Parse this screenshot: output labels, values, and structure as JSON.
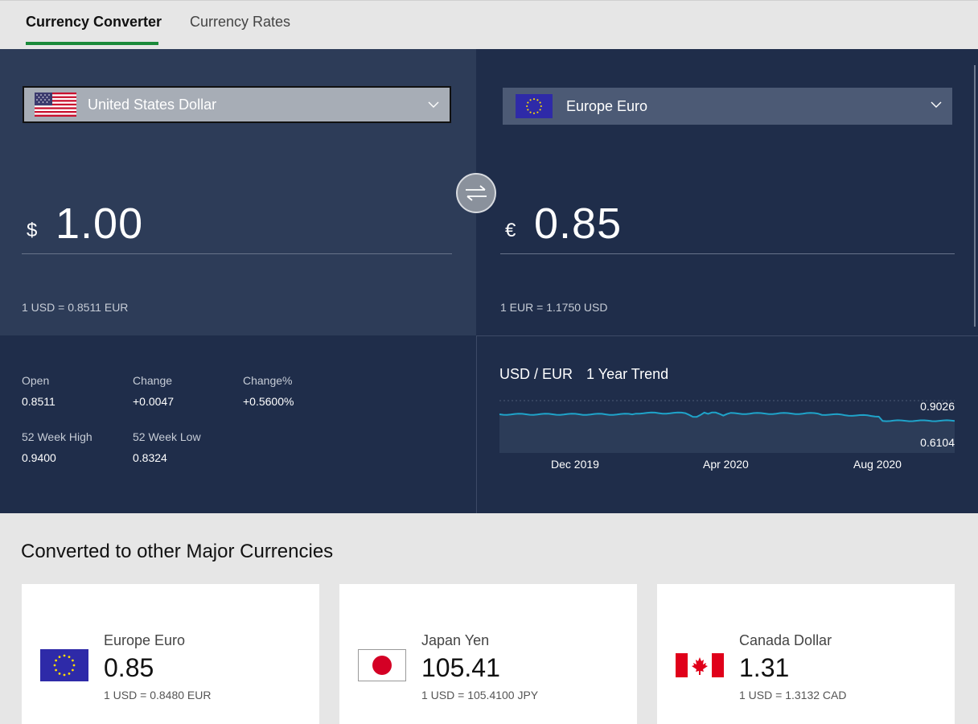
{
  "tabs": [
    {
      "label": "Currency Converter",
      "active": true
    },
    {
      "label": "Currency Rates",
      "active": false
    }
  ],
  "from": {
    "currency_name": "United States Dollar",
    "symbol": "$",
    "amount": "1.00",
    "rate_text": "1 USD  =  0.8511  EUR",
    "flag": "us-flag"
  },
  "to": {
    "currency_name": "Europe Euro",
    "symbol": "€",
    "amount": "0.85",
    "rate_text": "1 EUR  =  1.1750  USD",
    "flag": "eu-flag"
  },
  "swap_icon": "swap-arrows-icon",
  "stats": {
    "open_label": "Open",
    "open_value": "0.8511",
    "change_label": "Change",
    "change_value": "+0.0047",
    "changepct_label": "Change%",
    "changepct_value": "+0.5600%",
    "high_label": "52 Week High",
    "high_value": "0.9400",
    "low_label": "52 Week Low",
    "low_value": "0.8324"
  },
  "trend": {
    "pair": "USD / EUR",
    "period": "1 Year Trend",
    "max_label": "0.9026",
    "min_label": "0.6104",
    "x_labels": [
      "Dec 2019",
      "Apr 2020",
      "Aug 2020"
    ],
    "line_color": "#1fa3c9"
  },
  "bottom": {
    "title": "Converted to other Major Currencies",
    "cards": [
      {
        "name": "Europe Euro",
        "value": "0.85",
        "rate": "1 USD  =  0.8480  EUR",
        "flag": "eu-flag"
      },
      {
        "name": "Japan Yen",
        "value": "105.41",
        "rate": "1 USD  =  105.4100  JPY",
        "flag": "jp-flag"
      },
      {
        "name": "Canada Dollar",
        "value": "1.31",
        "rate": "1 USD  =  1.3132  CAD",
        "flag": "ca-flag"
      }
    ]
  },
  "colors": {
    "accent": "#1a8a3a",
    "panel_light": "#2d3c58",
    "panel_dark": "#1f2d4a"
  }
}
